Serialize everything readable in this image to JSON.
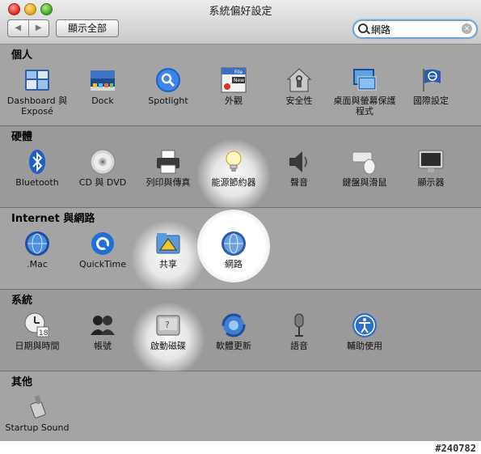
{
  "window": {
    "title": "系統偏好設定"
  },
  "toolbar": {
    "back": "◀",
    "forward": "▶",
    "show_all": "顯示全部"
  },
  "search": {
    "query": "網路",
    "clear": "×"
  },
  "categories": [
    {
      "title": "個人",
      "items": [
        {
          "label": "Dashboard 與 Exposé",
          "icon": "dashboard-expose-icon"
        },
        {
          "label": "Dock",
          "icon": "dock-icon"
        },
        {
          "label": "Spotlight",
          "icon": "spotlight-icon"
        },
        {
          "label": "外觀",
          "icon": "appearance-icon",
          "badge1": "File",
          "badge2": "New"
        },
        {
          "label": "安全性",
          "icon": "security-icon"
        },
        {
          "label": "桌面與螢幕保護程式",
          "icon": "desktop-screensaver-icon"
        },
        {
          "label": "國際設定",
          "icon": "international-icon"
        }
      ]
    },
    {
      "title": "硬體",
      "items": [
        {
          "label": "Bluetooth",
          "icon": "bluetooth-icon"
        },
        {
          "label": "CD 與 DVD",
          "icon": "cd-dvd-icon"
        },
        {
          "label": "列印與傳真",
          "icon": "print-fax-icon"
        },
        {
          "label": "能源節約器",
          "icon": "energy-saver-icon"
        },
        {
          "label": "聲音",
          "icon": "sound-icon"
        },
        {
          "label": "鍵盤與滑鼠",
          "icon": "keyboard-mouse-icon"
        },
        {
          "label": "顯示器",
          "icon": "displays-icon"
        }
      ]
    },
    {
      "title": "Internet 與網路",
      "items": [
        {
          "label": ".Mac",
          "icon": "dotmac-icon"
        },
        {
          "label": "QuickTime",
          "icon": "quicktime-icon"
        },
        {
          "label": "共享",
          "icon": "sharing-icon"
        },
        {
          "label": "網路",
          "icon": "network-icon"
        }
      ]
    },
    {
      "title": "系統",
      "items": [
        {
          "label": "日期與時間",
          "icon": "date-time-icon",
          "badge": "18"
        },
        {
          "label": "帳號",
          "icon": "accounts-icon"
        },
        {
          "label": "啟動磁碟",
          "icon": "startup-disk-icon"
        },
        {
          "label": "軟體更新",
          "icon": "software-update-icon"
        },
        {
          "label": "語音",
          "icon": "speech-icon"
        },
        {
          "label": "輔助使用",
          "icon": "universal-access-icon"
        }
      ]
    },
    {
      "title": "其他",
      "items": [
        {
          "label": "Startup Sound",
          "icon": "startup-sound-icon"
        }
      ]
    }
  ],
  "watermark": "#240782"
}
